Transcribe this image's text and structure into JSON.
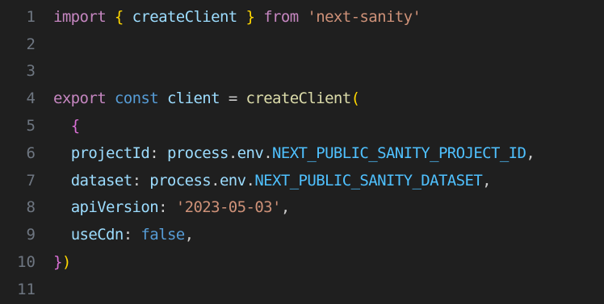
{
  "colors": {
    "background": "#1f1f1f",
    "line_number": "#6e7681",
    "keyword_control": "#c586c0",
    "keyword_storage": "#569cd6",
    "function": "#dcdcaa",
    "variable": "#9cdcfe",
    "constant": "#4fc1ff",
    "string": "#ce9178"
  },
  "lines": [
    {
      "number": "1",
      "tokens": [
        {
          "t": "import",
          "c": "kw"
        },
        {
          "t": " ",
          "c": "pun"
        },
        {
          "t": "{",
          "c": "br1"
        },
        {
          "t": " ",
          "c": "pun"
        },
        {
          "t": "createClient",
          "c": "var"
        },
        {
          "t": " ",
          "c": "pun"
        },
        {
          "t": "}",
          "c": "br1"
        },
        {
          "t": " ",
          "c": "pun"
        },
        {
          "t": "from",
          "c": "kw"
        },
        {
          "t": " ",
          "c": "pun"
        },
        {
          "t": "'next-sanity'",
          "c": "str"
        }
      ]
    },
    {
      "number": "2",
      "tokens": []
    },
    {
      "number": "3",
      "tokens": []
    },
    {
      "number": "4",
      "tokens": [
        {
          "t": "export",
          "c": "kw"
        },
        {
          "t": " ",
          "c": "pun"
        },
        {
          "t": "const",
          "c": "stor"
        },
        {
          "t": " ",
          "c": "pun"
        },
        {
          "t": "client",
          "c": "var"
        },
        {
          "t": " = ",
          "c": "pun"
        },
        {
          "t": "createClient",
          "c": "fn"
        },
        {
          "t": "(",
          "c": "br1"
        }
      ]
    },
    {
      "number": "5",
      "tokens": [
        {
          "t": "  ",
          "c": "pun"
        },
        {
          "t": "{",
          "c": "br2"
        }
      ]
    },
    {
      "number": "6",
      "tokens": [
        {
          "t": "  ",
          "c": "pun"
        },
        {
          "t": "projectId",
          "c": "var"
        },
        {
          "t": ": ",
          "c": "pun"
        },
        {
          "t": "process",
          "c": "var"
        },
        {
          "t": ".",
          "c": "pun"
        },
        {
          "t": "env",
          "c": "var"
        },
        {
          "t": ".",
          "c": "pun"
        },
        {
          "t": "NEXT_PUBLIC_SANITY_PROJECT_ID",
          "c": "cst"
        },
        {
          "t": ",",
          "c": "pun"
        }
      ]
    },
    {
      "number": "7",
      "tokens": [
        {
          "t": "  ",
          "c": "pun"
        },
        {
          "t": "dataset",
          "c": "var"
        },
        {
          "t": ": ",
          "c": "pun"
        },
        {
          "t": "process",
          "c": "var"
        },
        {
          "t": ".",
          "c": "pun"
        },
        {
          "t": "env",
          "c": "var"
        },
        {
          "t": ".",
          "c": "pun"
        },
        {
          "t": "NEXT_PUBLIC_SANITY_DATASET",
          "c": "cst"
        },
        {
          "t": ",",
          "c": "pun"
        }
      ]
    },
    {
      "number": "8",
      "tokens": [
        {
          "t": "  ",
          "c": "pun"
        },
        {
          "t": "apiVersion",
          "c": "var"
        },
        {
          "t": ": ",
          "c": "pun"
        },
        {
          "t": "'2023-05-03'",
          "c": "str"
        },
        {
          "t": ",",
          "c": "pun"
        }
      ]
    },
    {
      "number": "9",
      "tokens": [
        {
          "t": "  ",
          "c": "pun"
        },
        {
          "t": "useCdn",
          "c": "var"
        },
        {
          "t": ": ",
          "c": "pun"
        },
        {
          "t": "false",
          "c": "stor"
        },
        {
          "t": ",",
          "c": "pun"
        }
      ]
    },
    {
      "number": "10",
      "tokens": [
        {
          "t": "}",
          "c": "br2"
        },
        {
          "t": ")",
          "c": "br1"
        }
      ]
    },
    {
      "number": "11",
      "tokens": []
    }
  ]
}
